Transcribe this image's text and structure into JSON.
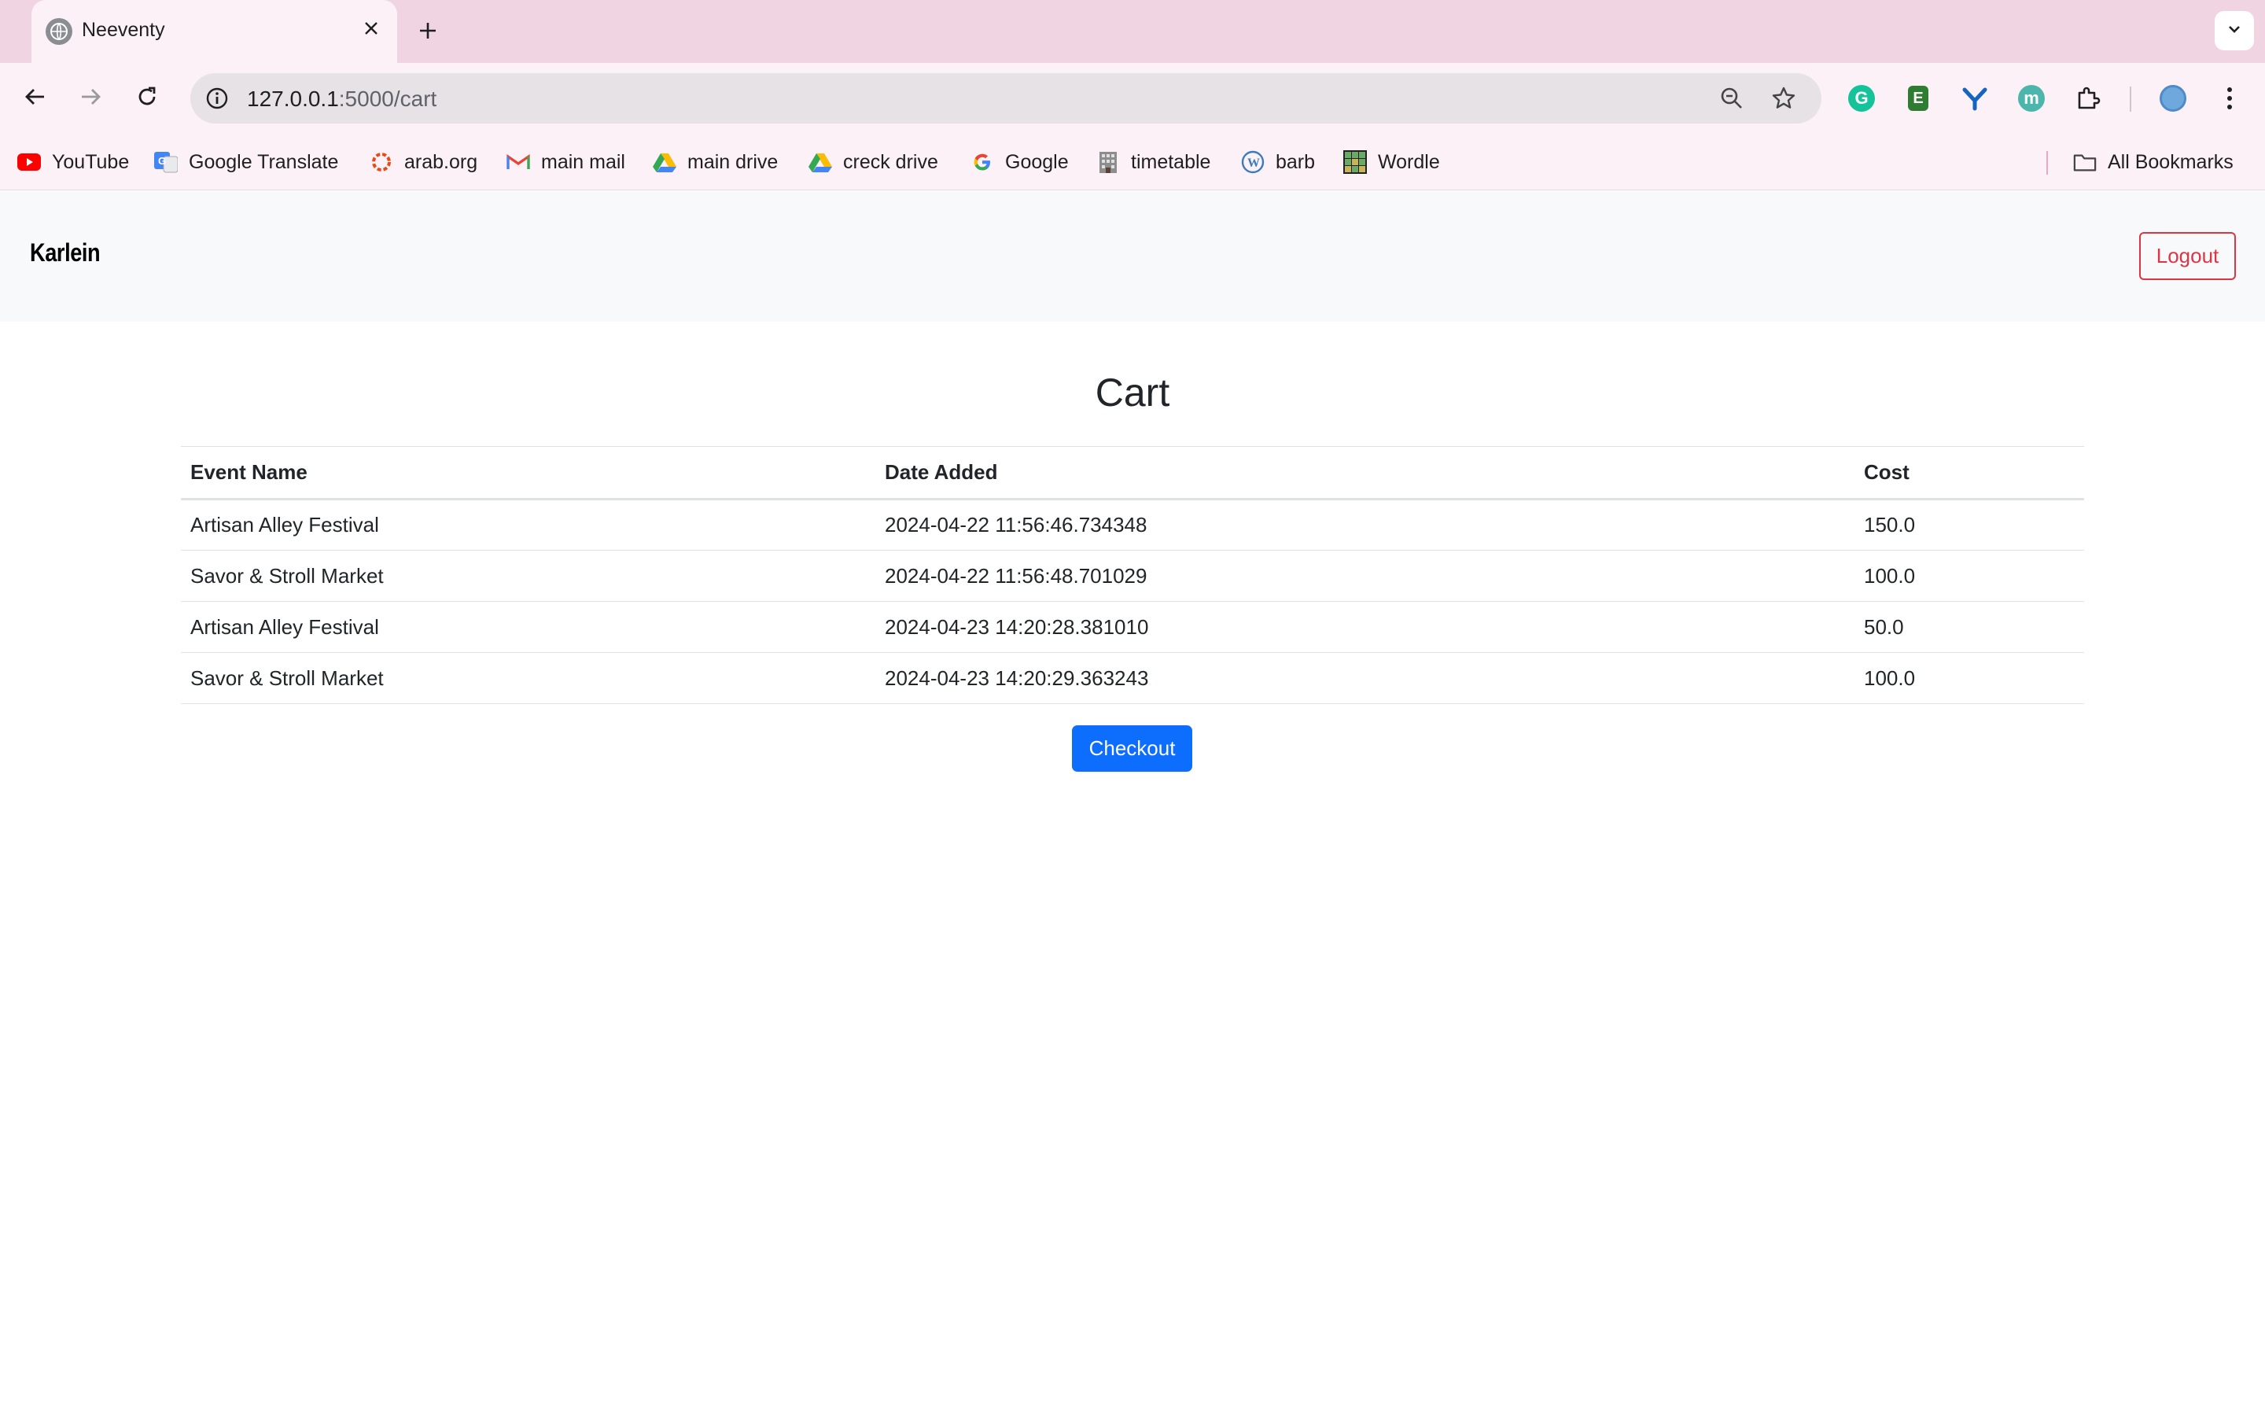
{
  "browser": {
    "tab_title": "Neeventy",
    "url_host": "127.0.0.1",
    "url_path": ":5000/cart",
    "bookmarks": [
      {
        "label": "YouTube",
        "icon": "youtube-icon"
      },
      {
        "label": "Google Translate",
        "icon": "google-translate-icon"
      },
      {
        "label": "arab.org",
        "icon": "arab-org-icon"
      },
      {
        "label": "main mail",
        "icon": "gmail-icon"
      },
      {
        "label": "main drive",
        "icon": "google-drive-icon"
      },
      {
        "label": "creck drive",
        "icon": "google-drive-icon"
      },
      {
        "label": "Google",
        "icon": "google-icon"
      },
      {
        "label": "timetable",
        "icon": "building-icon"
      },
      {
        "label": "barb",
        "icon": "wordpress-icon"
      },
      {
        "label": "Wordle",
        "icon": "wordle-icon"
      }
    ],
    "all_bookmarks_label": "All Bookmarks",
    "extensions": [
      {
        "icon": "grammarly-icon",
        "letter": "G",
        "color": "#15c39a"
      },
      {
        "icon": "evernote-icon",
        "letter": "E",
        "color": "#2e7d32"
      },
      {
        "icon": "y-extension-icon",
        "letter": "Y",
        "color": "#1565c0"
      },
      {
        "icon": "m-extension-icon",
        "letter": "m",
        "color": "#4db6ac"
      }
    ]
  },
  "navbar": {
    "brand": "Karlein",
    "logout_label": "Logout"
  },
  "page": {
    "heading": "Cart",
    "table": {
      "headers": [
        "Event Name",
        "Date Added",
        "Cost"
      ],
      "rows": [
        [
          "Artisan Alley Festival",
          "2024-04-22 11:56:46.734348",
          "150.0"
        ],
        [
          "Savor & Stroll Market",
          "2024-04-22 11:56:48.701029",
          "100.0"
        ],
        [
          "Artisan Alley Festival",
          "2024-04-23 14:20:28.381010",
          "50.0"
        ],
        [
          "Savor & Stroll Market",
          "2024-04-23 14:20:29.363243",
          "100.0"
        ]
      ]
    },
    "checkout_label": "Checkout"
  },
  "colors": {
    "tabstrip": "#f0d4e2",
    "danger": "#dc3545",
    "primary": "#0d6efd",
    "navbar_bg": "#f8f9fa"
  }
}
